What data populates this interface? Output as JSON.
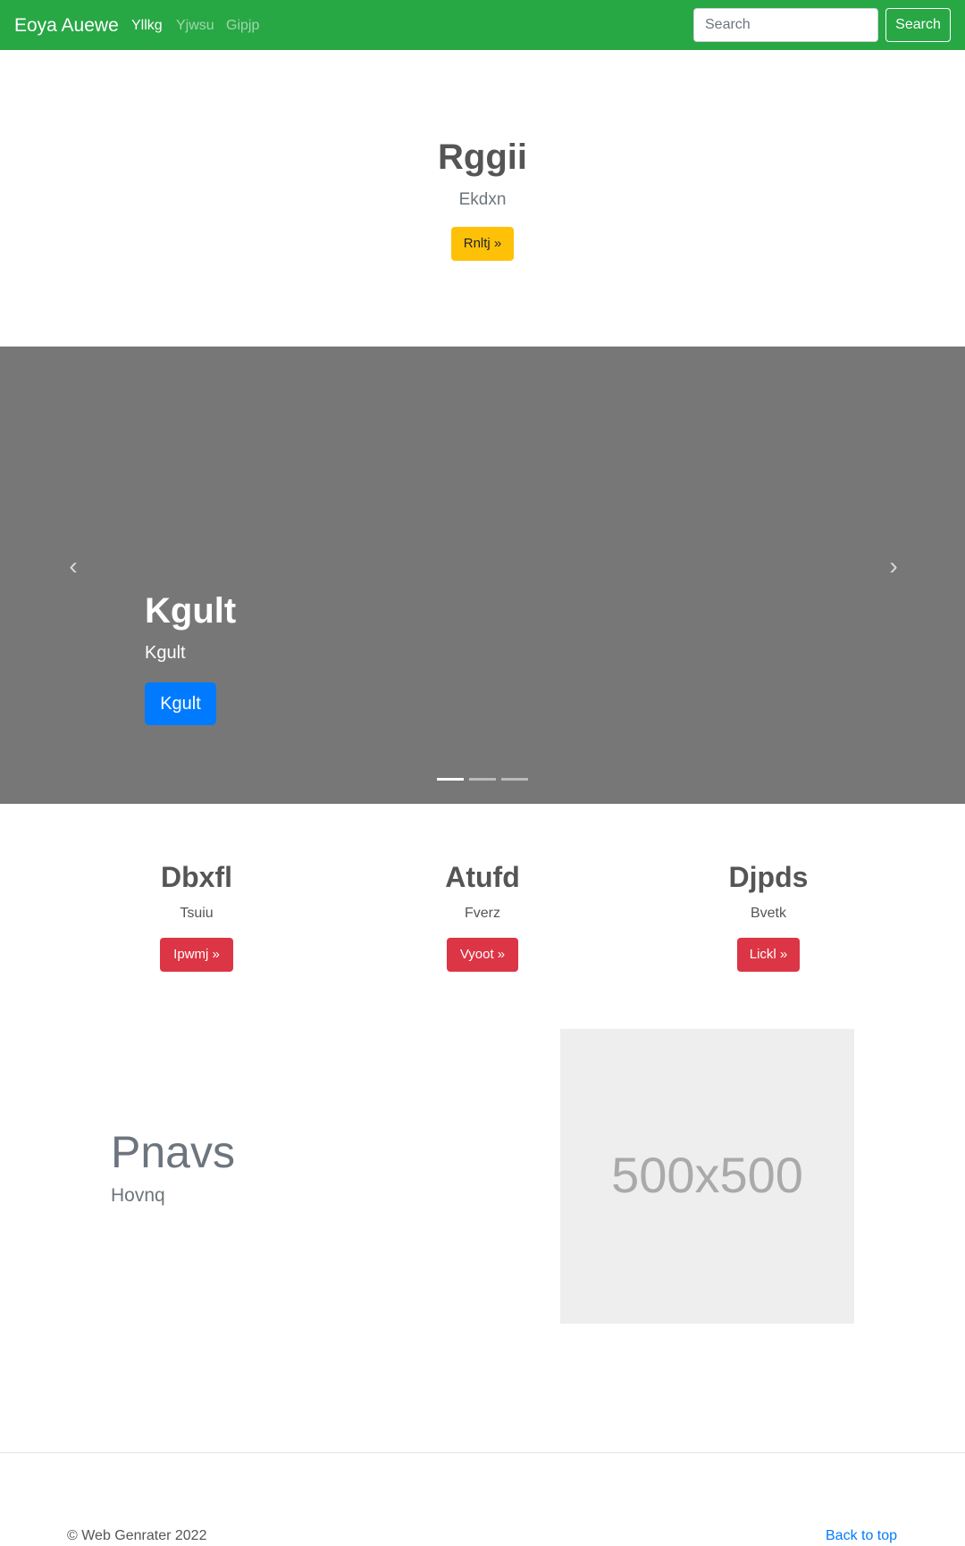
{
  "navbar": {
    "brand": "Eoya Auewe",
    "links": [
      {
        "label": "Yllkg",
        "active": true
      },
      {
        "label": "Yjwsu",
        "active": false
      },
      {
        "label": "Gipjp",
        "active": false
      }
    ],
    "search": {
      "placeholder": "Search",
      "button_label": "Search"
    },
    "background": "#28a745"
  },
  "hero": {
    "title": "Rggii",
    "subtitle": "Ekdxn",
    "button_label": "Rnltj »",
    "button_color": "#ffc107"
  },
  "carousel": {
    "title": "Kgult",
    "subtitle": "Kgult",
    "button_label": "Kgult",
    "button_color": "#007bff",
    "prev_icon": "‹",
    "next_icon": "›",
    "indicators": [
      true,
      false,
      false
    ]
  },
  "features": [
    {
      "title": "Dbxfl",
      "text": "Tsuiu",
      "button_label": "Ipwmj »"
    },
    {
      "title": "Atufd",
      "text": "Fverz",
      "button_label": "Vyoot »"
    },
    {
      "title": "Djpds",
      "text": "Bvetk",
      "button_label": "Lickl »"
    }
  ],
  "featurette": {
    "title": "Pnavs",
    "subtitle": "Hovnq",
    "image_text": "500x500"
  },
  "footer": {
    "copyright": "© Web Genrater 2022",
    "back_to_top": "Back to top"
  }
}
